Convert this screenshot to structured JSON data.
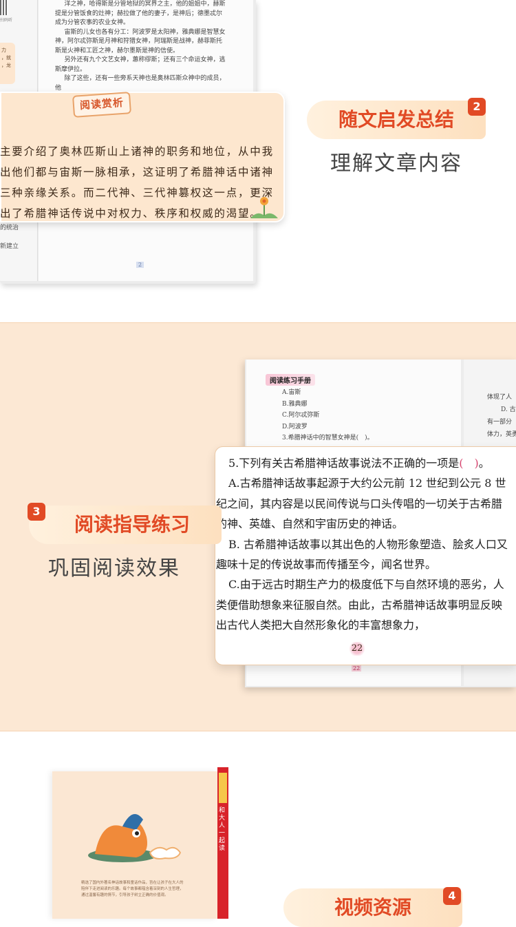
{
  "section1": {
    "qr_caption": "扫码听",
    "side_note": [
      "力",
      "，就",
      "，龙"
    ],
    "body_paragraphs": [
      "洋之神，哈得斯是分管地狱的冥界之主，他的姐姐中，赫斯提是分管饭食的灶神；赫拉做了他的妻子，是神后；德墨忒尔成为分管农事的农业女神。",
      "宙斯的儿女也各有分工：阿波罗是太阳神，雅典娜是智慧女神，阿尔忒弥斯是月神和狩猎女神，阿瑞斯是战神，赫菲斯托斯是火神和工匠之神，赫尔墨斯是神的信使。",
      "另外还有九个文艺女神，蕙称缪斯；还有三个命运女神，逃斯摩伊拉。",
      "除了这些，还有一些旁系天神也是奥林匹斯众神中的成员，他"
    ],
    "left_fragments": [
      "的统治",
      "新建立"
    ],
    "page_number": "2",
    "appreciation_label": "阅读赏析",
    "appreciation_lines": [
      "主要介绍了奥林匹斯山上诸神的职务和地位，从中我",
      "出他们都与宙斯一脉相承，这证明了希腊神话中诸神",
      "三种亲缘关系。而二代神、三代神篡权这一点，更深",
      "出了希腊神话传说中对权力、秩序和权威的渴望。"
    ],
    "feature_title": "随文启发总结",
    "feature_number": "2",
    "feature_subtitle": "理解文章内容"
  },
  "section2": {
    "manual_label": "阅读练习手册",
    "options": [
      "A.宙斯",
      "B.雅典娜",
      "C.阿尔忒弥斯",
      "D.阿波罗"
    ],
    "question3": "3.希腊神话中的智慧女神是(　)。",
    "right_page_lines": [
      "体现了人",
      "D. 古",
      "有一部分",
      "体力，英勇"
    ],
    "page_small": "22",
    "question5_prefix": "5.下列有关古希腊神话故事说法不正确的一项是",
    "question5_paren": "(　)",
    "question5_suffix": "。",
    "card_paragraphs": [
      "A.古希腊神话故事起源于大约公元前 12 世纪到公元 8 世纪之间，其内容是以民间传说与口头传唱的一切关于古希腊的神、英雄、自然和宇宙历史的神话。",
      "B. 古希腊神话故事以其出色的人物形象塑造、脍炙人口又趣味十足的传说故事而传播至今，闻名世界。",
      "C.由于远古时期生产力的极度低下与自然环境的恶劣，人类便借助想象来征服自然。由此，古希腊神话故事明显反映出古代人类把大自然形象化的丰富想象力，"
    ],
    "page_big": "22",
    "feature_title": "阅读指导练习",
    "feature_number": "3",
    "feature_subtitle": "巩固阅读效果"
  },
  "section3": {
    "box_side_title": "和大人一起读",
    "box_description": "精选了国内外著名神话故事和童话作品，旨在让孩子在大人的陪伴下走进阅读的乐趣。每个故事都蕴含着深刻的人生哲理，通过温馨有趣的情节，引导孩子树立正确的价值观。",
    "feature_title": "视频资源",
    "feature_number": "4"
  },
  "colors": {
    "accent": "#e14a25",
    "band": "#fce8d4",
    "appreciation_bg": "#fde7cf",
    "highlight_pink": "#d6456f"
  }
}
